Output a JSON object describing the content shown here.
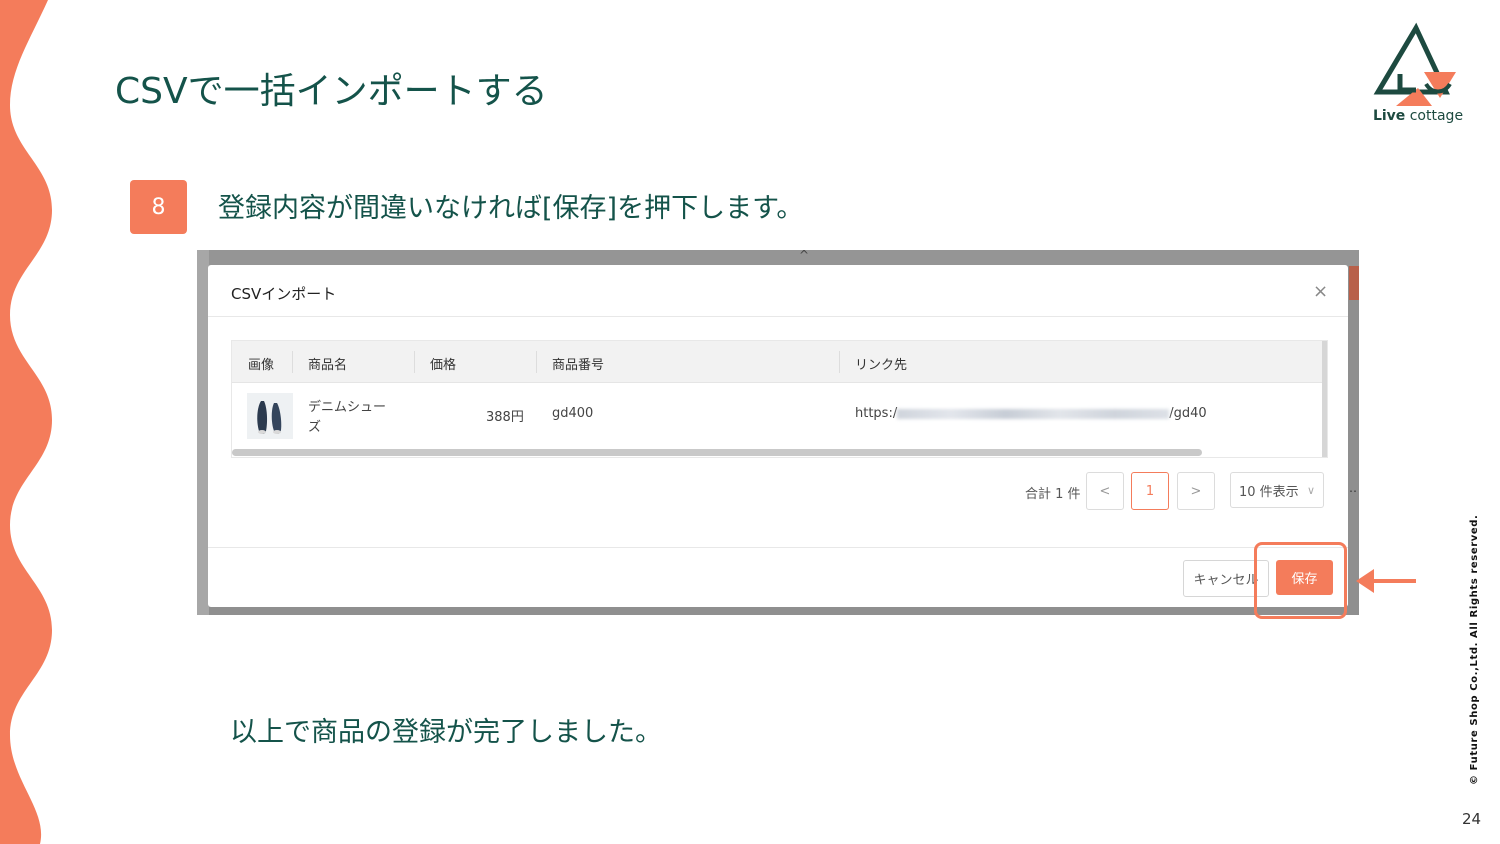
{
  "slide": {
    "title": "CSVで一括インポートする",
    "step_number": "8",
    "step_text": "登録内容が間違いなければ[保存]を押下します。",
    "bottom_text": "以上で商品の登録が完了しました。",
    "page_number": "24",
    "copyright": "© Future Shop Co.,Ltd. All Rights reserved.",
    "logo": {
      "name_bold": "Live",
      "name_rest": " cottage",
      "icon": "live-cottage-house-icon"
    },
    "accent_color": "#f47c5b",
    "text_color": "#14534a"
  },
  "modal": {
    "title": "CSVインポート",
    "close_icon": "×",
    "columns": [
      "画像",
      "商品名",
      "価格",
      "商品番号",
      "リンク先"
    ],
    "rows": [
      {
        "image": "shoes-thumbnail",
        "name_line1": "デニムシュー",
        "name_line2": "ズ",
        "price": "388円",
        "product_number": "gd400",
        "link_prefix": "https:/",
        "link_suffix": "/gd40"
      }
    ],
    "pagination": {
      "total": "合計 1 件",
      "prev": "<",
      "current_page": "1",
      "next": ">",
      "per_page": "10 件表示",
      "per_page_icon": "∨"
    },
    "cancel_label": "キャンセル",
    "save_label": "保存"
  }
}
